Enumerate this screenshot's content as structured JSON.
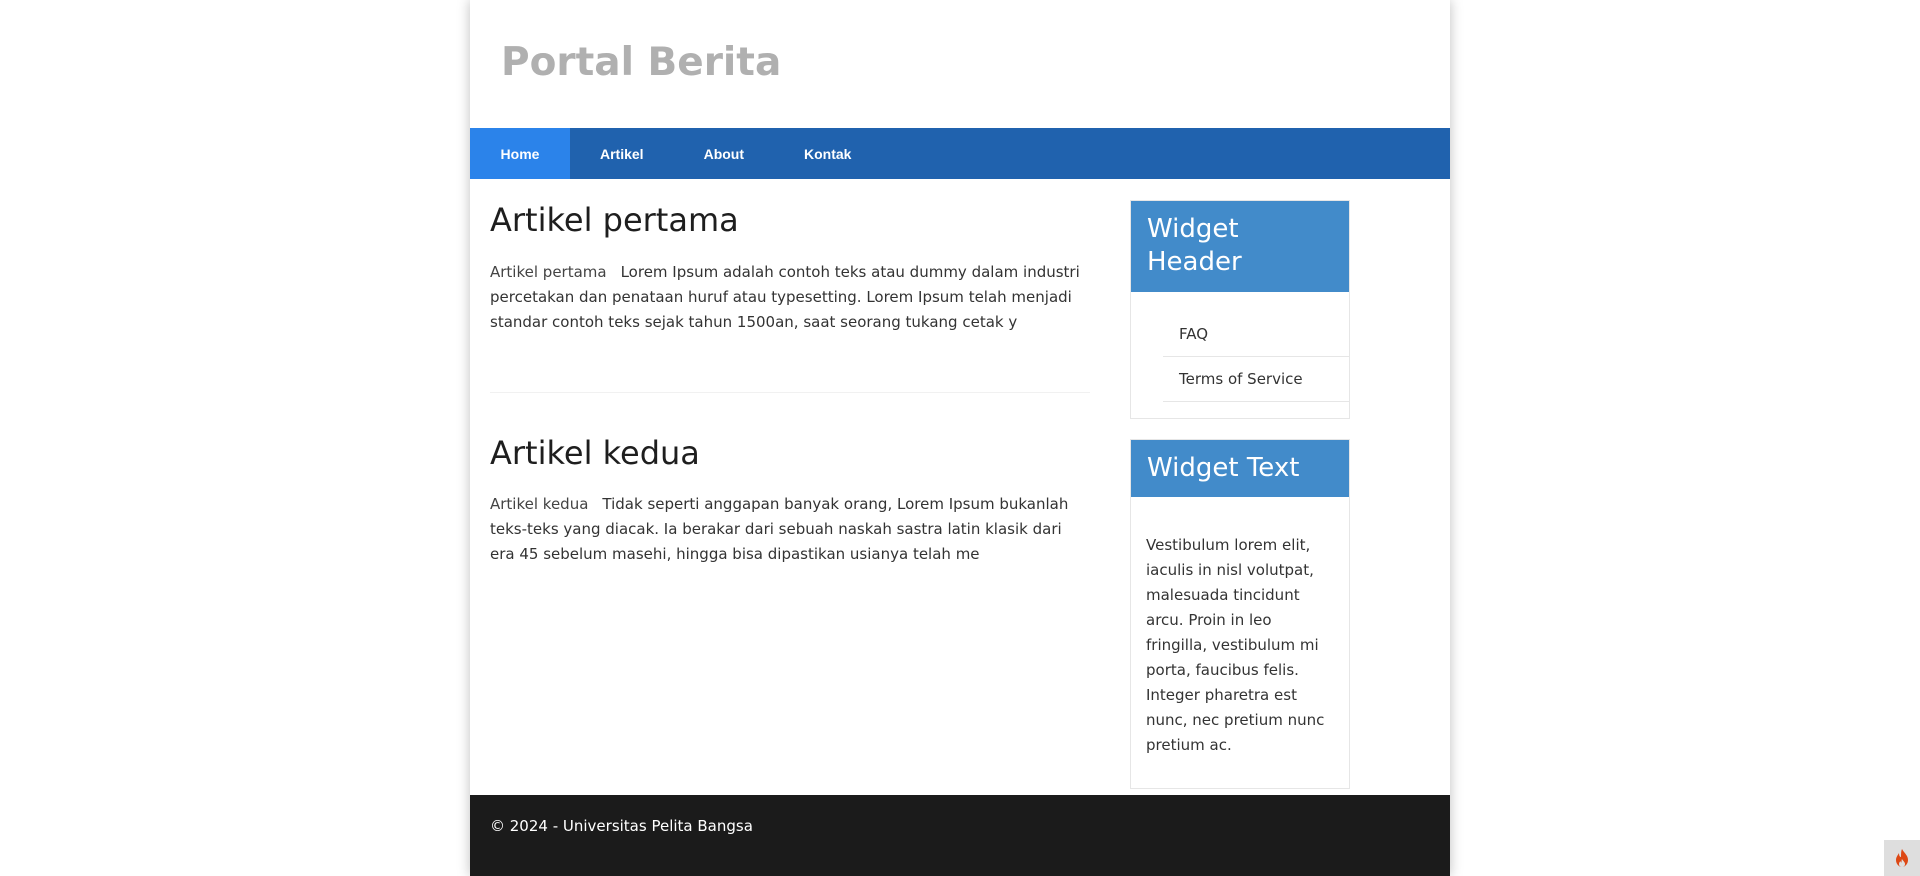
{
  "site": {
    "title": "Portal Berita"
  },
  "nav": {
    "items": [
      {
        "label": "Home",
        "active": true
      },
      {
        "label": "Artikel",
        "active": false
      },
      {
        "label": "About",
        "active": false
      },
      {
        "label": "Kontak",
        "active": false
      }
    ]
  },
  "articles": [
    {
      "title": "Artikel pertama",
      "image_alt": "Artikel pertama",
      "excerpt": "Lorem Ipsum adalah contoh teks atau dummy dalam industri percetakan dan penataan huruf atau typesetting. Lorem Ipsum telah menjadi standar contoh teks sejak tahun 1500an, saat seorang tukang cetak y"
    },
    {
      "title": "Artikel kedua",
      "image_alt": "Artikel kedua",
      "excerpt": "Tidak seperti anggapan banyak orang, Lorem Ipsum bukanlah teks-teks yang diacak. Ia berakar dari sebuah naskah sastra latin klasik dari era 45 sebelum masehi, hingga bisa dipastikan usianya telah me"
    }
  ],
  "sidebar": {
    "widget_header": {
      "title": "Widget Header",
      "links": [
        "FAQ",
        "Terms of Service"
      ]
    },
    "widget_text": {
      "title": "Widget Text",
      "body": "Vestibulum lorem elit, iaculis in nisl volutpat, malesuada tincidunt arcu. Proin in leo fringilla, vestibulum mi porta, faucibus felis. Integer pharetra est nunc, nec pretium nunc pretium ac."
    }
  },
  "footer": {
    "text": "© 2024 - Universitas Pelita Bangsa"
  },
  "colors": {
    "nav_bg": "#2062ae",
    "nav_active": "#2b83ea",
    "widget_header_bg": "#428bca",
    "footer_bg": "#1b1b1b",
    "site_title": "#b0b0b0"
  },
  "icons": {
    "debug_toolbar": "flame-icon"
  }
}
